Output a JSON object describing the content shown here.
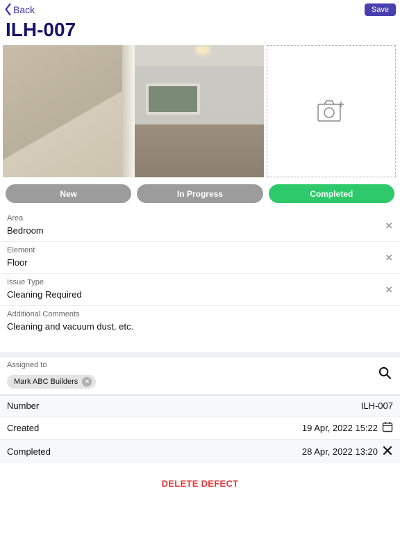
{
  "header": {
    "back_label": "Back",
    "save_label": "Save"
  },
  "title": "ILH-007",
  "add_photo_icon": "camera-add-icon",
  "status": {
    "new": "New",
    "in_progress": "In Progress",
    "completed": "Completed"
  },
  "fields": {
    "area": {
      "label": "Area",
      "value": "Bedroom"
    },
    "element": {
      "label": "Element",
      "value": "Floor"
    },
    "issue_type": {
      "label": "Issue Type",
      "value": "Cleaning Required"
    },
    "comments": {
      "label": "Additional Comments",
      "value": "Cleaning and vacuum dust, etc."
    }
  },
  "assigned": {
    "label": "Assigned to",
    "chip": "Mark ABC Builders"
  },
  "meta": {
    "number": {
      "label": "Number",
      "value": "ILH-007"
    },
    "created": {
      "label": "Created",
      "value": "19 Apr, 2022 15:22"
    },
    "completed": {
      "label": "Completed",
      "value": "28 Apr, 2022 13:20"
    }
  },
  "delete_label": "DELETE DEFECT",
  "colors": {
    "accent": "#3a2db3",
    "success": "#2ec96a",
    "danger": "#e33a3a"
  }
}
